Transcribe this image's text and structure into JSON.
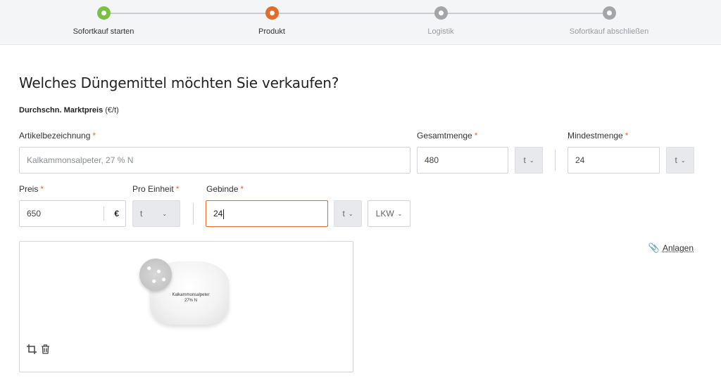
{
  "stepper": {
    "steps": [
      {
        "label": "Sofortkauf starten",
        "state": "done",
        "color": "#7ac143"
      },
      {
        "label": "Produkt",
        "state": "active",
        "color": "#e36c2a"
      },
      {
        "label": "Logistik",
        "state": "inactive",
        "color": "#a3a5ab"
      },
      {
        "label": "Sofortkauf abschließen",
        "state": "inactive",
        "color": "#a3a5ab"
      }
    ]
  },
  "page": {
    "title": "Welches Düngemittel möchten Sie verkaufen?",
    "market_price_label": "Durchschn. Marktpreis",
    "market_price_unit": "(€/t)"
  },
  "form": {
    "required_mark": "*",
    "artikel": {
      "label": "Artikelbezeichnung",
      "placeholder": "Kalkammonsalpeter, 27 % N"
    },
    "gesamtmenge": {
      "label": "Gesamtmenge",
      "value": "480",
      "unit": "t"
    },
    "mindestmenge": {
      "label": "Mindestmenge",
      "value": "24",
      "unit": "t"
    },
    "preis": {
      "label": "Preis",
      "value": "650",
      "currency": "€"
    },
    "pro_einheit": {
      "label": "Pro Einheit",
      "value": "t"
    },
    "gebinde": {
      "label": "Gebinde",
      "value": "24",
      "unit": "t",
      "type": "LKW"
    }
  },
  "attachments": {
    "label": "Anlagen",
    "icon": "paperclip-icon"
  },
  "image_panel": {
    "product_label_line1": "Kalkammonsalpeter",
    "product_label_line2": "27% N",
    "tools": [
      "crop-icon",
      "trash-icon"
    ]
  },
  "colors": {
    "accent": "#e36c2a",
    "done": "#7ac143",
    "inactive": "#a3a5ab"
  }
}
